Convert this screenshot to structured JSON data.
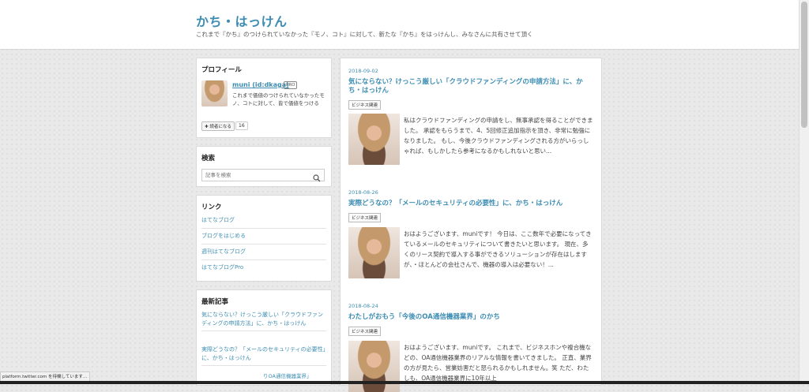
{
  "header": {
    "title": "かち・はっけん",
    "description": "これまで『かち』のつけられていなかった『モノ、コト』に対して、新たな『かち』をはっけんし、みなさんに共有させて頂く"
  },
  "profile": {
    "heading": "プロフィール",
    "name": "muni (id:dkaga)",
    "badge": "PRO",
    "bio": "これまで価値のつけられていなかったモノ、コトに対して、皆で価値をつける",
    "follow_label": "✚ 読者になる",
    "follow_count": "16"
  },
  "search": {
    "heading": "検索",
    "placeholder": "記事を検索"
  },
  "links": {
    "heading": "リンク",
    "items": [
      "はてなブログ",
      "ブログをはじめる",
      "週刊はてなブログ",
      "はてなブログPro"
    ]
  },
  "recent": {
    "heading": "最新記事",
    "items": [
      "気にならない？けっこう厳しい「クラウドファンディングの申請方法」に、かち・はっけん",
      "実際どうなの？「メールのセキュリティの必要性」に、かち・はっけん"
    ],
    "peek": "りOA通信機器業界」"
  },
  "entries": [
    {
      "date": "2018-09-02",
      "title": "気にならない？けっこう厳しい「クラウドファンディングの申請方法」に、かち・はっけん",
      "category": "ビジネス関連",
      "excerpt": "私はクラウドファンディングの申請をし、無事承認を得ることができました。 承認をもらうまで、4、5回修正追加指示を頂き、非常に勉強になりました。 もし、今後クラウドファンディングされる方がいらっしゃれば、もしかしたら参考になるかもしれないと思い..."
    },
    {
      "date": "2018-08-26",
      "title": "実際どうなの？「メールのセキュリティの必要性」に、かち・はっけん",
      "category": "ビジネス関連",
      "excerpt": "おはようございます、muniです！ 今日は、ここ数年で必要になってきているメールのセキュリティについて書きたいと思います。 現在、多くのリース契約で導入する事ができるソリューションが存在はしますが、・ほとんどの会社さんで、機器の導入は必要ない！..."
    },
    {
      "date": "2018-08-24",
      "title": "わたしがおもう「今後のOA通信機器業界」のかち",
      "category": "ビジネス関連",
      "excerpt": "おはようございます、muniです。 これまで、ビジネスホンや複合機などの、OA通信機器業界のリアルな情報を書いてきました。 正直、業界の方が見たら、営業妨害だと怒られるかもしれません。笑 ただ、わたしも、OA通信機器業界に10年以上"
    }
  ],
  "statusbar": {
    "text": "platform.twitter.com を待機しています..."
  }
}
